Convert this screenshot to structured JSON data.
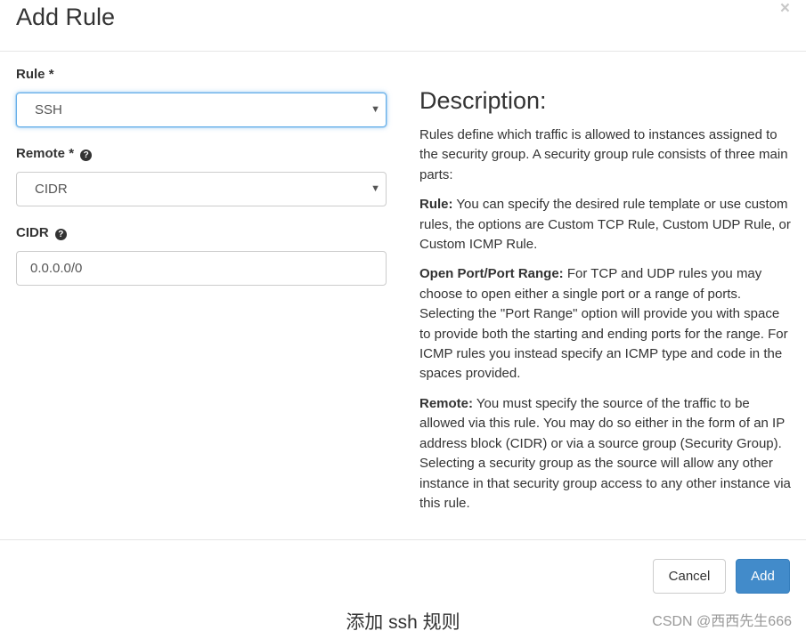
{
  "modal": {
    "title": "Add Rule",
    "close_glyph": "×"
  },
  "form": {
    "rule": {
      "label": "Rule",
      "required_mark": "*",
      "value": "SSH"
    },
    "remote": {
      "label": "Remote",
      "required_mark": "*",
      "value": "CIDR"
    },
    "cidr": {
      "label": "CIDR",
      "value": "0.0.0.0/0"
    },
    "help_glyph": "?",
    "caret_glyph": "▼"
  },
  "description": {
    "title": "Description:",
    "intro": "Rules define which traffic is allowed to instances assigned to the security group. A security group rule consists of three main parts:",
    "rule_term": "Rule:",
    "rule_text": " You can specify the desired rule template or use custom rules, the options are Custom TCP Rule, Custom UDP Rule, or Custom ICMP Rule.",
    "port_term": "Open Port/Port Range:",
    "port_text": " For TCP and UDP rules you may choose to open either a single port or a range of ports. Selecting the \"Port Range\" option will provide you with space to provide both the starting and ending ports for the range. For ICMP rules you instead specify an ICMP type and code in the spaces provided.",
    "remote_term": "Remote:",
    "remote_text": " You must specify the source of the traffic to be allowed via this rule. You may do so either in the form of an IP address block (CIDR) or via a source group (Security Group). Selecting a security group as the source will allow any other instance in that security group access to any other instance via this rule."
  },
  "footer": {
    "cancel_label": "Cancel",
    "add_label": "Add"
  },
  "caption": "添加 ssh 规则",
  "watermark": "CSDN @西西先生666",
  "colors": {
    "primary": "#428bca",
    "focus": "#66afe9"
  }
}
